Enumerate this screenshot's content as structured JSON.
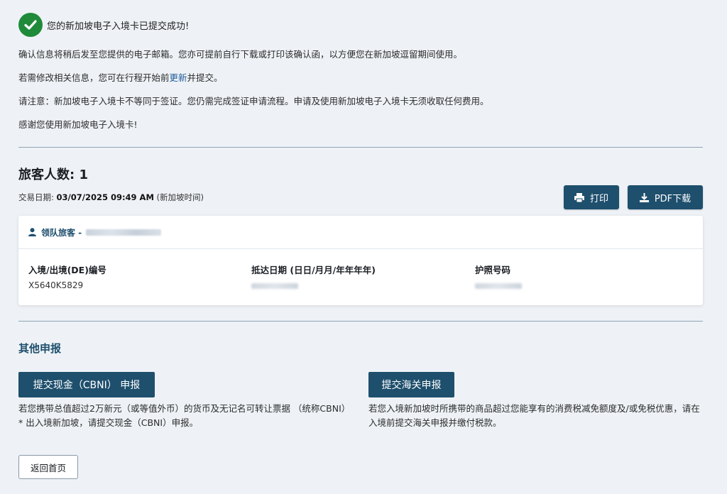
{
  "success": {
    "message": "您的新加坡电子入境卡已提交成功!"
  },
  "info": {
    "line1": "确认信息将稍后发至您提供的电子邮箱。您亦可提前自行下载或打印该确认函，以方便您在新加坡逗留期间使用。",
    "line2_before": "若需修改相关信息，您可在行程开始前",
    "line2_link": "更新",
    "line2_after": "并提交。",
    "line3": "请注意：新加坡电子入境卡不等同于签证。您仍需完成签证申请流程。申请及使用新加坡电子入境卡无须收取任何费用。",
    "line4": "感谢您使用新加坡电子入境卡!"
  },
  "summary": {
    "travelers_label": "旅客人数: 1",
    "tx_label": "交易日期: ",
    "tx_date": "03/07/2025 09:49 AM",
    "tx_tz": " (新加坡时间)"
  },
  "actions": {
    "print_label": "打印",
    "pdf_label": "PDF下载"
  },
  "traveler_card": {
    "lead_label": "领队旅客 -",
    "fields": [
      {
        "label": "入境/出境(DE)编号",
        "value": "X5640K5829"
      },
      {
        "label": "抵达日期 (日日/月月/年年年年)",
        "value": ""
      },
      {
        "label": "护照号码",
        "value": ""
      }
    ]
  },
  "other": {
    "title": "其他申报",
    "cbni_button": "提交现金（CBNI） 申报",
    "cbni_desc": "若您携带总值超过2万新元（或等值外币）的货币及无记名可转让票据 （统称CBNI）* 出入境新加坡，请提交现金（CBNI）申报。",
    "customs_button": "提交海关申报",
    "customs_desc": "若您入境新加坡时所携带的商品超过您能享有的消费税减免额度及/或免税优惠，请在入境前提交海关申报并缴付税款。"
  },
  "back_label": "返回首页",
  "colors": {
    "success": "#1f8a3a",
    "primary": "#1e4f6d",
    "link": "#1f5a9a",
    "background": "#eef2f6"
  }
}
